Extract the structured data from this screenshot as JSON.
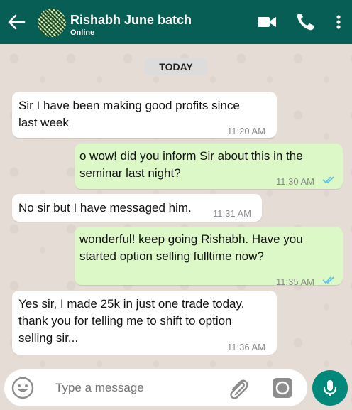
{
  "header": {
    "chat_name": "Rishabh June batch '",
    "status": "Online",
    "back_icon": "arrow-left-icon",
    "video_icon": "video-camera-icon",
    "call_icon": "phone-icon",
    "menu_icon": "more-vertical-icon",
    "background_color": "#075e54"
  },
  "date_chip": "TODAY",
  "messages": [
    {
      "direction": "incoming",
      "text_line1": "Sir I have been making good profits since",
      "text_line2": "last week",
      "time": "11:20 AM"
    },
    {
      "direction": "outgoing",
      "text_line1": "o wow! did you inform Sir about this in the",
      "text_line2": "seminar last night?",
      "time": "11:30 AM",
      "read": true
    },
    {
      "direction": "incoming",
      "text_line1": "No sir but I have messaged him.",
      "time": "11:31 AM"
    },
    {
      "direction": "outgoing",
      "text_line1": "wonderful! keep going Rishabh. Have you",
      "text_line2": "started option selling fulltime now?",
      "time": "11:35 AM",
      "read": true
    },
    {
      "direction": "incoming",
      "text_line1": "Yes sir, I made 25k in just one trade today.",
      "text_line2": "thank you for telling me to shift to option",
      "text_line3": "selling sir...",
      "time": "11:36 AM"
    }
  ],
  "composer": {
    "placeholder": "Type a message",
    "emoji_icon": "emoji-icon",
    "attach_icon": "paperclip-icon",
    "camera_icon": "camera-icon",
    "mic_icon": "microphone-icon"
  },
  "colors": {
    "incoming_bubble": "#ffffff",
    "outgoing_bubble": "#dcf8c6",
    "read_tick": "#4fc3f7",
    "mic_button": "#00897b"
  }
}
